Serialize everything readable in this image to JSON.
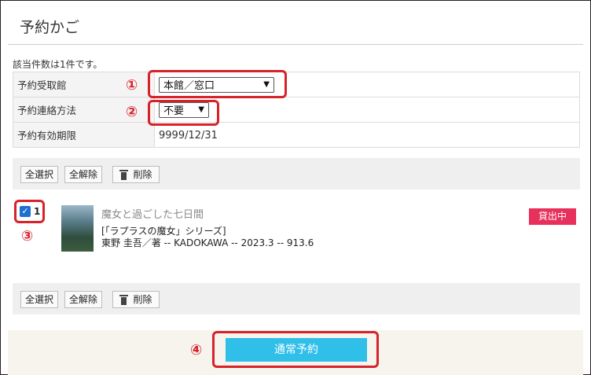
{
  "page": {
    "title": "予約かご",
    "result_count": "該当件数は1件です。"
  },
  "form": {
    "pickup_label": "予約受取館",
    "pickup_value": "本館／窓口",
    "contact_label": "予約連絡方法",
    "contact_value": "不要",
    "expiry_label": "予約有効期限",
    "expiry_value": "9999/12/31"
  },
  "toolbar": {
    "select_all": "全選択",
    "deselect_all": "全解除",
    "delete": "削除"
  },
  "item": {
    "number": "1",
    "title": "魔女と過ごした七日間",
    "series": "[「ラプラスの魔女」シリーズ]",
    "meta": "東野 圭吾／著 -- KADOKAWA -- 2023.3 -- 913.6",
    "status_badge": "貸出中",
    "checked": true
  },
  "actions": {
    "submit_label": "通常予約"
  },
  "annotations": {
    "m1": "①",
    "m2": "②",
    "m3": "③",
    "m4": "④"
  },
  "colors": {
    "accent": "#2fbfe8",
    "badge": "#e7305b",
    "annotation": "#d8222a"
  }
}
